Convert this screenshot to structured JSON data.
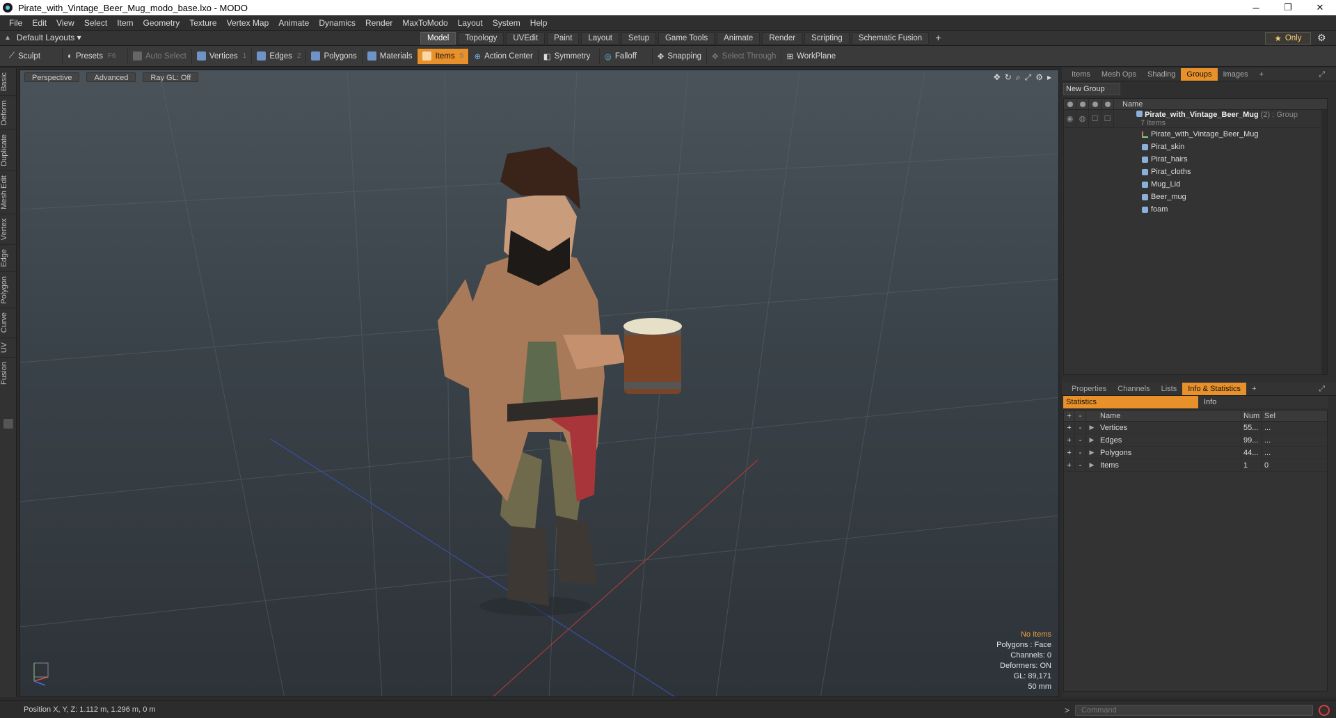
{
  "window": {
    "title": "Pirate_with_Vintage_Beer_Mug_modo_base.lxo - MODO",
    "minimize": "─",
    "maximize": "❐",
    "close": "✕"
  },
  "menu": [
    "File",
    "Edit",
    "View",
    "Select",
    "Item",
    "Geometry",
    "Texture",
    "Vertex Map",
    "Animate",
    "Dynamics",
    "Render",
    "MaxToModo",
    "Layout",
    "System",
    "Help"
  ],
  "layout_dropdown": "Default Layouts ▾",
  "mode_tabs": [
    "Model",
    "Topology",
    "UVEdit",
    "Paint",
    "Layout",
    "Setup",
    "Game Tools",
    "Animate",
    "Render",
    "Scripting",
    "Schematic Fusion"
  ],
  "mode_tab_active": "Model",
  "only_label": "Only",
  "toolbar": {
    "sculpt": "Sculpt",
    "presets": "Presets",
    "presets_key": "F6",
    "auto_select": "Auto Select",
    "vertices": "Vertices",
    "vertices_key": "1",
    "edges": "Edges",
    "edges_key": "2",
    "polygons": "Polygons",
    "materials": "Materials",
    "items": "Items",
    "items_key": "5",
    "action_center": "Action Center",
    "symmetry": "Symmetry",
    "falloff": "Falloff",
    "snapping": "Snapping",
    "select_through": "Select Through",
    "workplane": "WorkPlane"
  },
  "left_tabs": [
    "Basic",
    "Deform",
    "Duplicate",
    "Mesh Edit",
    "Vertex",
    "Edge",
    "Polygon",
    "Curve",
    "UV",
    "Fusion"
  ],
  "viewport": {
    "view": "Perspective",
    "shading": "Advanced",
    "raygl": "Ray GL: Off",
    "stats": {
      "no_items": "No Items",
      "polygons": "Polygons : Face",
      "channels": "Channels: 0",
      "deformers": "Deformers: ON",
      "gl": "GL: 89,171",
      "focal": "50 mm"
    }
  },
  "panel_top": {
    "tabs": [
      "Items",
      "Mesh Ops",
      "Shading",
      "Groups",
      "Images"
    ],
    "active": "Groups",
    "new_group": "New Group",
    "col_name": "Name",
    "group": {
      "name": "Pirate_with_Vintage_Beer_Mug",
      "count": "(2)",
      "type": ": Group",
      "sub": "7 Items"
    },
    "children": [
      "Pirate_with_Vintage_Beer_Mug",
      "Pirat_skin",
      "Pirat_hairs",
      "Pirat_cloths",
      "Mug_Lid",
      "Beer_mug",
      "foam"
    ]
  },
  "panel_bottom": {
    "tabs": [
      "Properties",
      "Channels",
      "Lists",
      "Info & Statistics"
    ],
    "active": "Info & Statistics",
    "sub_tabs": {
      "statistics": "Statistics",
      "info": "Info"
    },
    "headers": {
      "name": "Name",
      "num": "Num",
      "sel": "Sel"
    },
    "rows": [
      {
        "name": "Vertices",
        "num": "55...",
        "sel": "..."
      },
      {
        "name": "Edges",
        "num": "99...",
        "sel": "..."
      },
      {
        "name": "Polygons",
        "num": "44...",
        "sel": "..."
      },
      {
        "name": "Items",
        "num": "1",
        "sel": "0"
      }
    ]
  },
  "status": {
    "position": "Position X, Y, Z:  1.112 m, 1.296 m, 0 m",
    "command_placeholder": "Command"
  }
}
